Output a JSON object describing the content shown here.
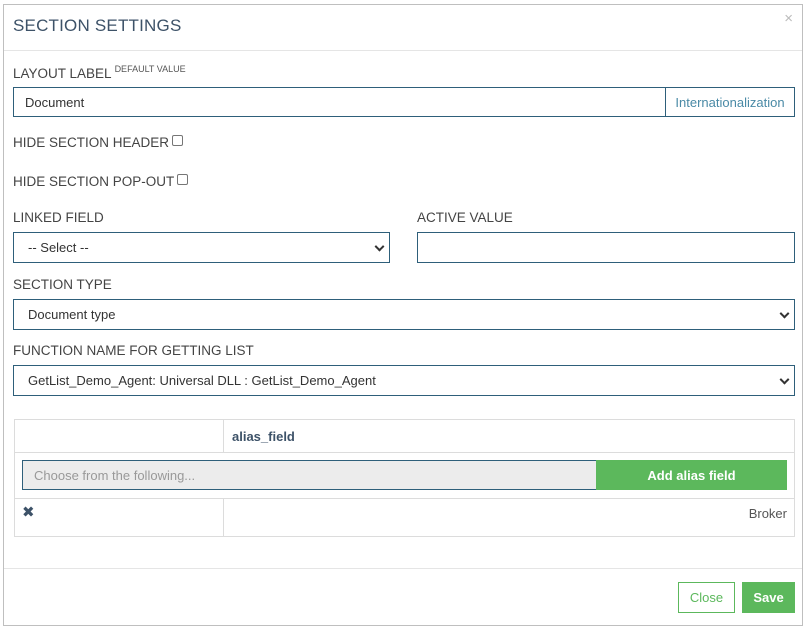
{
  "modal": {
    "title": "SECTION SETTINGS",
    "close_glyph": "×"
  },
  "layout_label": {
    "label": "LAYOUT LABEL",
    "sup": "DEFAULT VALUE",
    "value": "Document",
    "addon": "Internationalization"
  },
  "hide_section_header": {
    "label": "HIDE SECTION HEADER",
    "checked": false
  },
  "hide_section_popout": {
    "label": "HIDE SECTION POP-OUT",
    "checked": false
  },
  "linked_field": {
    "label": "LINKED FIELD",
    "selected": "-- Select --"
  },
  "active_value": {
    "label": "ACTIVE VALUE",
    "value": ""
  },
  "section_type": {
    "label": "SECTION TYPE",
    "selected": "Document type"
  },
  "function_name": {
    "label": "FUNCTION NAME FOR GETTING LIST",
    "selected": "GetList_Demo_Agent: Universal DLL : GetList_Demo_Agent"
  },
  "alias_table": {
    "header": "alias_field",
    "input_placeholder": "Choose from the following...",
    "add_button": "Add alias field",
    "rows": [
      {
        "delete_glyph": "✖",
        "value": "Broker"
      }
    ]
  },
  "footer": {
    "close_label": "Close",
    "save_label": "Save"
  },
  "colors": {
    "accent_green": "#5cb85c",
    "title_blue": "#3d5268",
    "input_border": "#2e5f7a"
  }
}
